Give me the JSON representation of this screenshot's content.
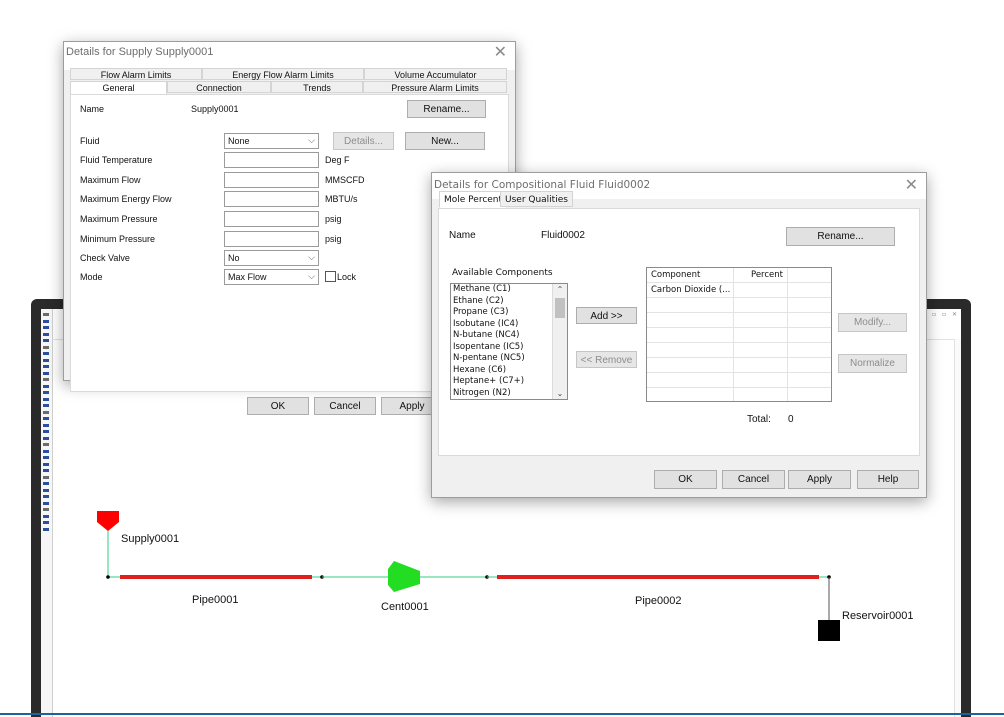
{
  "supply_dialog": {
    "title": "Details for Supply Supply0001",
    "close_glyph": "✕",
    "tabs_row1": [
      "Flow Alarm Limits",
      "Energy Flow Alarm Limits",
      "Volume Accumulator"
    ],
    "tabs_row2": [
      "General",
      "Connection",
      "Trends",
      "Pressure Alarm Limits"
    ],
    "active_tab": "General",
    "name_label": "Name",
    "name_value": "Supply0001",
    "rename_button": "Rename...",
    "fields": [
      {
        "label": "Fluid",
        "kind": "select",
        "value": "None"
      },
      {
        "label": "Fluid Temperature",
        "kind": "input",
        "value": "",
        "unit": "Deg F"
      },
      {
        "label": "Maximum Flow",
        "kind": "input",
        "value": "",
        "unit": "MMSCFD"
      },
      {
        "label": "Maximum Energy Flow",
        "kind": "input",
        "value": "",
        "unit": "MBTU/s"
      },
      {
        "label": "Maximum Pressure",
        "kind": "input",
        "value": "",
        "unit": "psig"
      },
      {
        "label": "Minimum Pressure",
        "kind": "input",
        "value": "",
        "unit": "psig"
      },
      {
        "label": "Check Valve",
        "kind": "select",
        "value": "No"
      },
      {
        "label": "Mode",
        "kind": "select",
        "value": "Max Flow"
      }
    ],
    "details_button": "Details...",
    "new_button": "New...",
    "lock_label": "Lock",
    "lock_checked": false,
    "ok_button": "OK",
    "cancel_button": "Cancel",
    "apply_button": "Apply"
  },
  "fluid_dialog": {
    "title": "Details for Compositional Fluid Fluid0002",
    "close_glyph": "✕",
    "tabs": [
      "Mole Percent",
      "User Qualities"
    ],
    "active_tab": "Mole Percent",
    "name_label": "Name",
    "name_value": "Fluid0002",
    "rename_button": "Rename...",
    "available_label": "Available Components",
    "available_components": [
      "Methane (C1)",
      "Ethane (C2)",
      "Propane (C3)",
      "Isobutane (IC4)",
      "N-butane (NC4)",
      "Isopentane (IC5)",
      "N-pentane (NC5)",
      "Hexane (C6)",
      "Heptane+ (C7+)",
      "Nitrogen (N2)"
    ],
    "add_button": "Add >>",
    "remove_button": "<< Remove",
    "grid_headers": [
      "Component",
      "Percent"
    ],
    "grid_rows": [
      [
        "Carbon Dioxide (...",
        ""
      ]
    ],
    "modify_button": "Modify...",
    "normalize_button": "Normalize",
    "total_label": "Total:",
    "total_value": "0",
    "ok_button": "OK",
    "cancel_button": "Cancel",
    "apply_button": "Apply",
    "help_button": "Help"
  },
  "network": {
    "supply_label": "Supply0001",
    "pipe1_label": "Pipe0001",
    "compressor_label": "Cent0001",
    "pipe2_label": "Pipe0002",
    "reservoir_label": "Reservoir0001"
  },
  "colors": {
    "pipe": "#e0201e",
    "supply": "#ff0000",
    "compressor": "#22dd22",
    "link": "#33cc88",
    "reservoir": "#000000",
    "accent_line": "#1e5fa8"
  }
}
